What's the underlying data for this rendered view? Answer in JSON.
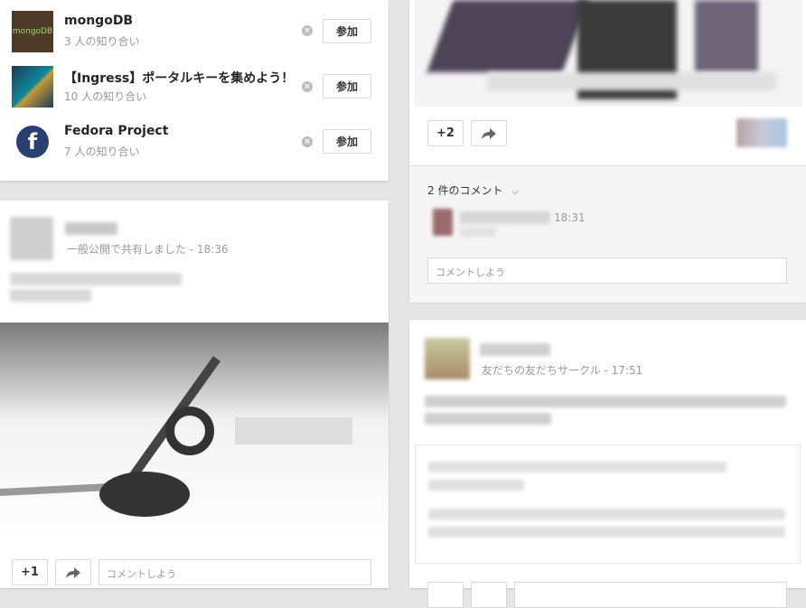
{
  "suggestions": [
    {
      "name": "mongoDB",
      "sub": "3 人の知り合い",
      "join": "参加",
      "logo_color": "#4f3a2a"
    },
    {
      "name": "【Ingress】ポータルキーを集めよう！",
      "sub": "10 人の知り合い",
      "join": "参加",
      "logo_color": "#1c3a55"
    },
    {
      "name": "Fedora Project",
      "sub": "7 人の知り合い",
      "join": "参加",
      "logo_color": "#294172"
    }
  ],
  "post_left": {
    "visibility": "一般公開で共有しました",
    "time": "18:36",
    "plus": "+1",
    "comment_placeholder": "コメントしよう"
  },
  "post_right_top": {
    "plus": "+2",
    "comment_count": "2 件のコメント",
    "comment_time": "18:31",
    "comment_placeholder": "コメントしよう"
  },
  "post_right_bottom": {
    "circle": "友だちの友だちサークル",
    "time": "17:51"
  },
  "colors": {
    "background": "#e5e5e5",
    "card": "#ffffff",
    "border": "#d9d9d9"
  }
}
